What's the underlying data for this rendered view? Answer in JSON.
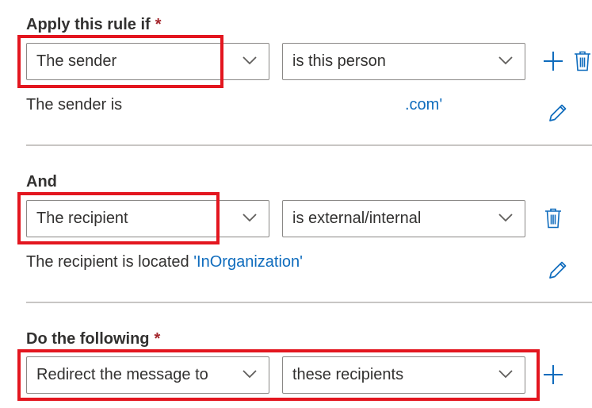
{
  "condition1": {
    "label": "Apply this rule if",
    "required_mark": "*",
    "field": "The sender",
    "operator": "is this person",
    "summary_text": "The sender is",
    "summary_value": ".com'"
  },
  "condition2": {
    "label": "And",
    "field": "The recipient",
    "operator": "is external/internal",
    "summary_text": "The recipient is located",
    "summary_value": "'InOrganization'"
  },
  "action": {
    "label": "Do the following",
    "required_mark": "*",
    "field": "Redirect the message to",
    "operator": "these recipients"
  },
  "colors": {
    "accent": "#0f6cbd",
    "required": "#a4262c",
    "highlight": "#e3161f"
  },
  "icons": [
    "chevron-down-icon",
    "plus-icon",
    "trash-icon",
    "pencil-icon"
  ]
}
